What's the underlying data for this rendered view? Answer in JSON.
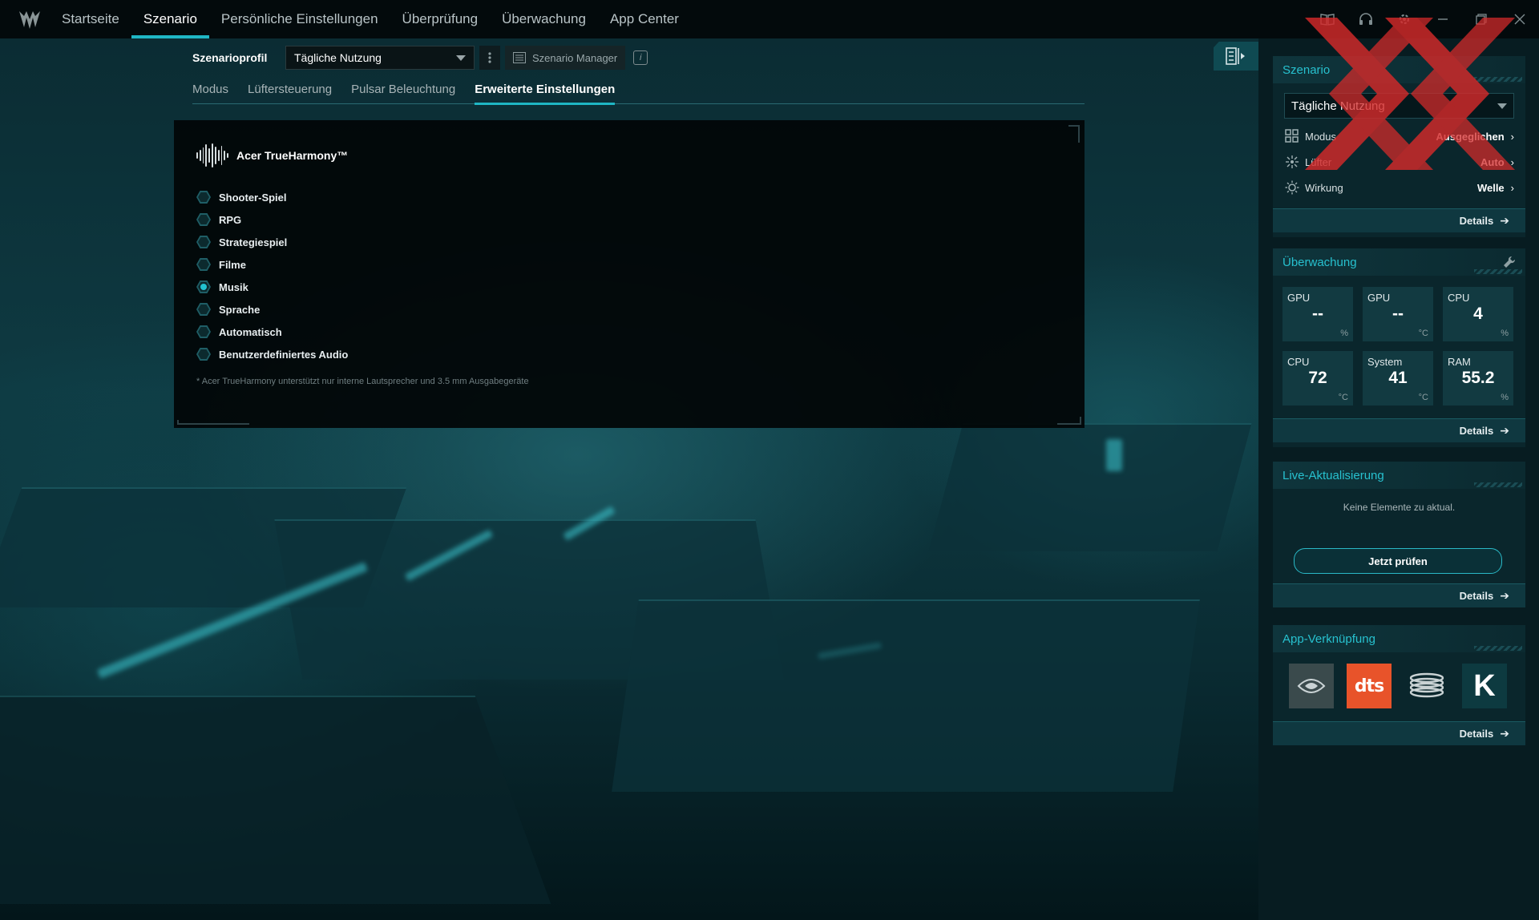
{
  "nav": {
    "items": [
      "Startseite",
      "Szenario",
      "Persönliche Einstellungen",
      "Überprüfung",
      "Überwachung",
      "App Center"
    ],
    "active": "Szenario"
  },
  "subheader": {
    "label": "Szenarioprofil",
    "profile_value": "Tägliche Nutzung",
    "manager_label": "Szenario Manager"
  },
  "tabs": {
    "items": [
      "Modus",
      "Lüftersteuerung",
      "Pulsar Beleuchtung",
      "Erweiterte Einstellungen"
    ],
    "active": "Erweiterte Einstellungen"
  },
  "trueharmony": {
    "title": "Acer TrueHarmony™",
    "options": [
      {
        "label": "Shooter-Spiel",
        "selected": false
      },
      {
        "label": "RPG",
        "selected": false
      },
      {
        "label": "Strategiespiel",
        "selected": false
      },
      {
        "label": "Filme",
        "selected": false
      },
      {
        "label": "Musik",
        "selected": true
      },
      {
        "label": "Sprache",
        "selected": false
      },
      {
        "label": "Automatisch",
        "selected": false
      },
      {
        "label": "Benutzerdefiniertes Audio",
        "selected": false
      }
    ],
    "footnote": "* Acer TrueHarmony unterstützt nur interne Lautsprecher und 3.5 mm Ausgabegeräte"
  },
  "sidebar": {
    "scenario_card": {
      "title": "Szenario",
      "select_value": "Tägliche Nutzung",
      "rows": [
        {
          "icon": "grid-icon",
          "label": "Modus",
          "value": "Ausgeglichen"
        },
        {
          "icon": "fan-icon",
          "label": "Lüfter",
          "value": "Auto"
        },
        {
          "icon": "sun-icon",
          "label": "Wirkung",
          "value": "Welle"
        }
      ],
      "details": "Details"
    },
    "monitor_card": {
      "title": "Überwachung",
      "tiles": [
        {
          "label": "GPU",
          "value": "--",
          "unit": "%"
        },
        {
          "label": "GPU",
          "value": "--",
          "unit": "°C"
        },
        {
          "label": "CPU",
          "value": "4",
          "unit": "%"
        },
        {
          "label": "CPU",
          "value": "72",
          "unit": "°C"
        },
        {
          "label": "System",
          "value": "41",
          "unit": "°C"
        },
        {
          "label": "RAM",
          "value": "55.2",
          "unit": "%"
        }
      ],
      "details": "Details"
    },
    "live_card": {
      "title": "Live-Aktualisierung",
      "message": "Keine Elemente zu aktual.",
      "button": "Jetzt prüfen",
      "details": "Details"
    },
    "apps_card": {
      "title": "App-Verknüpfung",
      "apps": [
        {
          "name": "nvidia-app-icon"
        },
        {
          "name": "dts-app-icon",
          "text": "dts"
        },
        {
          "name": "coil-app-icon"
        },
        {
          "name": "k-app-icon",
          "text": "K"
        }
      ],
      "details": "Details"
    }
  },
  "colors": {
    "accent": "#1fb6c4",
    "watermark": "#d42a2a"
  }
}
